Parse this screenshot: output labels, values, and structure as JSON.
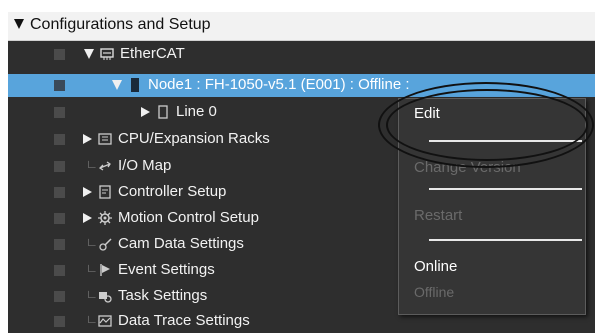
{
  "header": {
    "title": "Configurations and Setup"
  },
  "tree": {
    "ethercat": "EtherCAT",
    "node1": "Node1 : FH-1050-v5.1 (E001) : Offline :",
    "line0": "Line 0",
    "cpu": "CPU/Expansion Racks",
    "io": "I/O Map",
    "controller": "Controller Setup",
    "motion": "Motion Control Setup",
    "cam": "Cam Data Settings",
    "event": "Event Settings",
    "task": "Task Settings",
    "trace": "Data Trace Settings"
  },
  "context_menu": {
    "edit": "Edit",
    "change_version": "Change Version",
    "restart": "Restart",
    "online": "Online",
    "offline": "Offline"
  },
  "colors": {
    "selection": "#58a4dc",
    "background": "#2e2e2e",
    "menu_bg": "#353535",
    "disabled_text": "#6a6a6a"
  },
  "icons": [
    "expand-triangle-icon",
    "ethercat-icon",
    "device-icon",
    "doc-icon",
    "rack-icon",
    "io-map-icon",
    "controller-icon",
    "gear-icon",
    "cam-icon",
    "flag-icon",
    "task-icon",
    "trace-icon"
  ]
}
